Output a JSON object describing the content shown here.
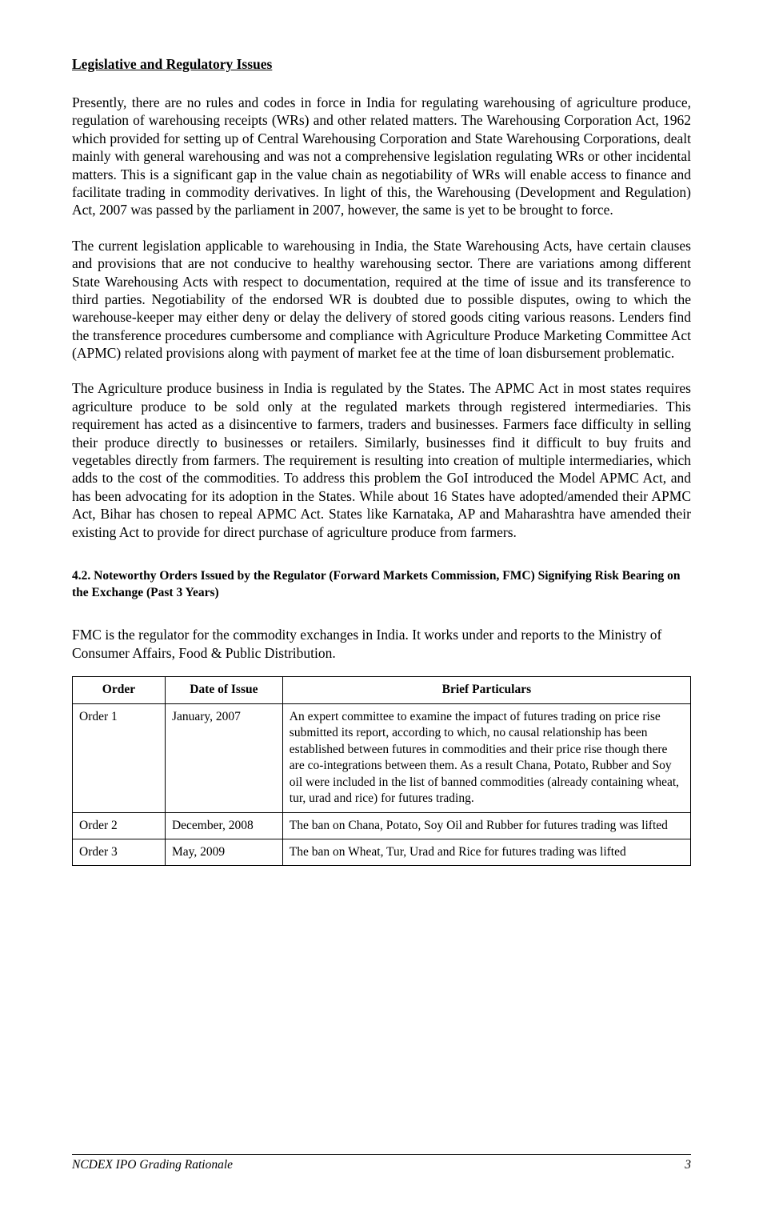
{
  "heading": "Legislative and Regulatory Issues",
  "paragraphs": [
    "Presently, there are no rules and codes in force in India for regulating warehousing of agriculture produce, regulation of warehousing receipts (WRs) and other related matters. The Warehousing Corporation Act, 1962 which provided for setting up of Central Warehousing Corporation and State Warehousing Corporations, dealt mainly with general warehousing and was not a comprehensive legislation regulating WRs or other incidental matters. This is a significant gap in the value chain as negotiability of WRs will enable access to finance and facilitate trading in commodity derivatives. In light of this, the Warehousing (Development and Regulation) Act, 2007 was passed by the parliament in 2007, however, the same is yet to be brought to force.",
    "The current legislation applicable to warehousing in India, the State Warehousing Acts, have certain clauses and provisions that are not conducive to healthy warehousing sector. There are variations among different State Warehousing Acts with respect to documentation, required at the time of issue and its transference to third parties. Negotiability of the endorsed WR is doubted due to possible disputes, owing to which the warehouse-keeper may either deny or delay the delivery of stored goods citing various reasons. Lenders find the transference procedures cumbersome and compliance with Agriculture Produce Marketing Committee Act (APMC) related provisions along with payment of market fee at the time of loan disbursement problematic.",
    "The Agriculture produce business in India is regulated by the States. The APMC Act in most states requires agriculture produce to be sold only at the regulated markets through registered intermediaries. This requirement has acted as a disincentive to farmers, traders and businesses. Farmers face difficulty in selling their produce directly to businesses or retailers. Similarly, businesses find it difficult to buy fruits and vegetables directly from farmers. The requirement is resulting into creation of multiple intermediaries, which adds to the cost of the commodities. To address this problem the GoI introduced the Model APMC Act, and has been advocating for its adoption in the States. While about 16 States have adopted/amended their APMC Act, Bihar has chosen to repeal APMC Act. States like Karnataka, AP and Maharashtra have amended their existing Act to provide for direct purchase of agriculture produce from farmers."
  ],
  "risk_heading": "4.2. Noteworthy Orders Issued by the Regulator (Forward Markets Commission, FMC) Signifying Risk Bearing on the Exchange (Past 3 Years)",
  "intro": "FMC is the regulator for the commodity exchanges in India. It works under and reports to the Ministry of Consumer Affairs, Food & Public Distribution.",
  "table": {
    "headers": [
      "Order",
      "Date of Issue",
      "Brief Particulars"
    ],
    "rows": [
      [
        "Order 1",
        "January, 2007",
        "An expert committee to examine the impact of futures trading on price rise submitted its report, according to which, no causal relationship has been established between futures in commodities and their price rise though there are co-integrations between them. As a result Chana, Potato, Rubber and Soy oil were included in the list of banned commodities (already containing wheat, tur, urad and rice) for futures trading."
      ],
      [
        "Order 2",
        "December, 2008",
        "The ban on Chana, Potato, Soy Oil and Rubber for futures trading was lifted"
      ],
      [
        "Order 3",
        "May, 2009",
        "The ban on Wheat, Tur, Urad and Rice for futures trading was lifted"
      ]
    ]
  },
  "footer": {
    "left": "NCDEX IPO Grading Rationale",
    "right": "3"
  }
}
